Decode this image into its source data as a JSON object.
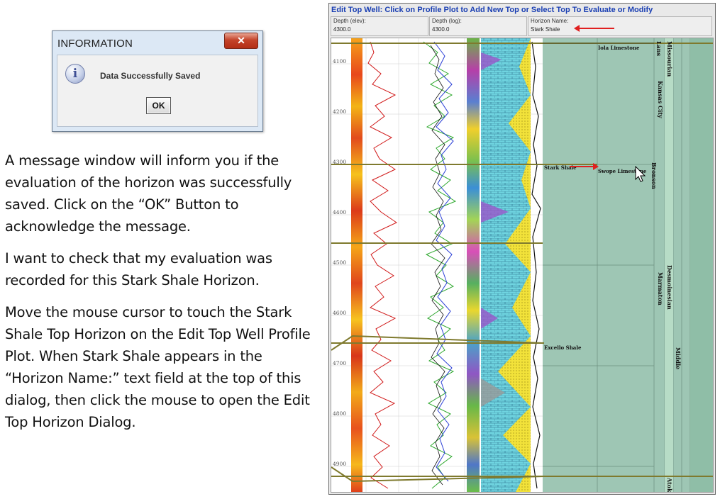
{
  "dialog": {
    "title": "INFORMATION",
    "close_glyph": "✕",
    "icon": "info-icon",
    "message": "Data Successfully Saved",
    "ok_label": "OK"
  },
  "instructions": {
    "p1": "A message window will inform you if the evaluation of the horizon was successfully saved.  Click on the “OK” Button to acknowledge the message.",
    "p2": "I want to check that my evaluation was recorded for this Stark Shale Horizon.",
    "p3": "Move the mouse cursor to touch the Stark Shale Top Horizon on the Edit Top Well Profile Plot.  When Stark Shale appears in the “Horizon Name:” text field at the top of this dialog, then click the mouse to open the Edit Top Horizon Dialog."
  },
  "panel": {
    "title": "Edit Top Well: Click on Profile Plot to Add New Top or Select Top To Evaluate or Modify",
    "depth_elev_label": "Depth (elev):",
    "depth_elev_value": "4300.0",
    "depth_log_label": "Depth (log):",
    "depth_log_value": "4300.0",
    "horizon_label": "Horizon Name:",
    "horizon_value": "Stark Shale"
  },
  "plot": {
    "depth_labels": [
      "4100",
      "4200",
      "4300",
      "4400",
      "4500",
      "4600",
      "4700",
      "4800",
      "4900"
    ],
    "tops": {
      "iola": "Iola Limestone",
      "stark": "Stark Shale",
      "swope": "Swope Limestone",
      "excello": "Excello Shale"
    },
    "units": {
      "missourian": "Missourian",
      "lansing": "Lans",
      "kansas_city": "Kansas City",
      "bronson": "Bronson",
      "desmoinesian": "Desmoinesian",
      "marmaton": "Marmaton",
      "middle": "Middle",
      "atoka": "Atoka"
    }
  },
  "colors": {
    "accent_title": "#1a3fb3",
    "arrow": "#e02020",
    "panel_green": "#9ec6b4",
    "horizon_line": "#7f7a2e"
  }
}
